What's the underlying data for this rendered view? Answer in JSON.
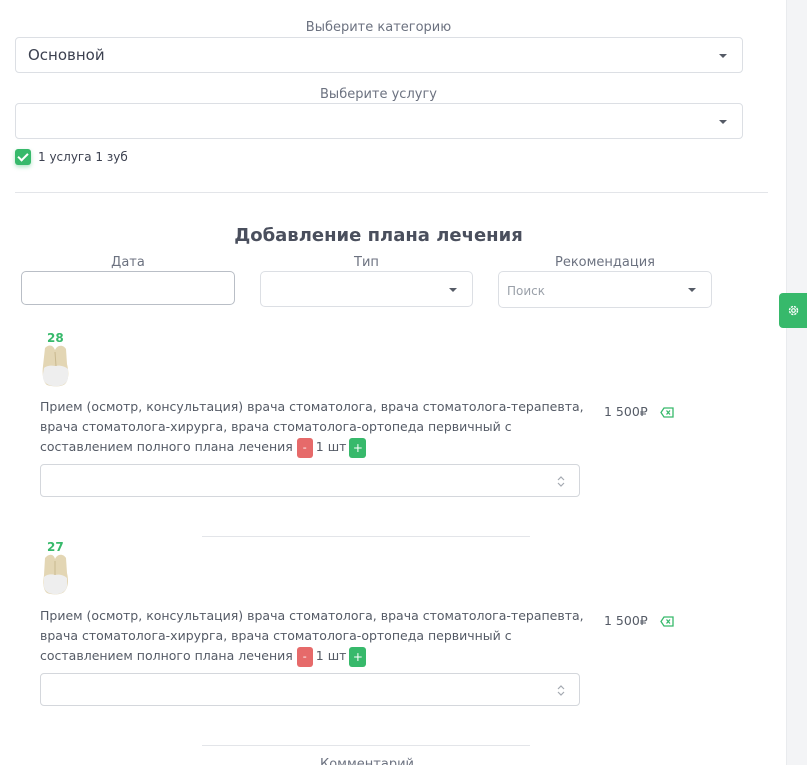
{
  "category": {
    "label": "Выберите категорию",
    "value": "Основной"
  },
  "service_select": {
    "label": "Выберите услугу",
    "value": ""
  },
  "one_service_one_tooth": {
    "label": "1 услуга 1 зуб",
    "checked": true
  },
  "plan": {
    "title": "Добавление плана лечения",
    "date_label": "Дата",
    "date_value": "",
    "type_label": "Тип",
    "type_value": "",
    "recommendation_label": "Рекомендация",
    "search_placeholder": "Поиск"
  },
  "items": [
    {
      "tooth": "28",
      "service_line1": "Прием (осмотр, консультация) врача стоматолога, врача стоматолога-терапевта,",
      "service_line2": "врача стоматолога-хирурга, врача стоматолога-ортопеда первичный с",
      "service_line3": "составлением полного плана лечения",
      "minus": "-",
      "qty": "1 шт",
      "plus": "+",
      "price": "1 500₽"
    },
    {
      "tooth": "27",
      "service_line1": "Прием (осмотр, консультация) врача стоматолога, врача стоматолога-терапевта,",
      "service_line2": "врача стоматолога-хирурга, врача стоматолога-ортопеда первичный с",
      "service_line3": "составлением полного плана лечения",
      "minus": "-",
      "qty": "1 шт",
      "plus": "+",
      "price": "1 500₽"
    }
  ],
  "footer_cut_text": "Комментарий",
  "colors": {
    "accent": "#37b96b",
    "danger": "#e66a6a"
  },
  "icons": {
    "settings": "gear-icon",
    "delete": "backspace-icon",
    "dropdown": "chevron-down-icon",
    "stepper": "up-down-arrows-icon"
  }
}
